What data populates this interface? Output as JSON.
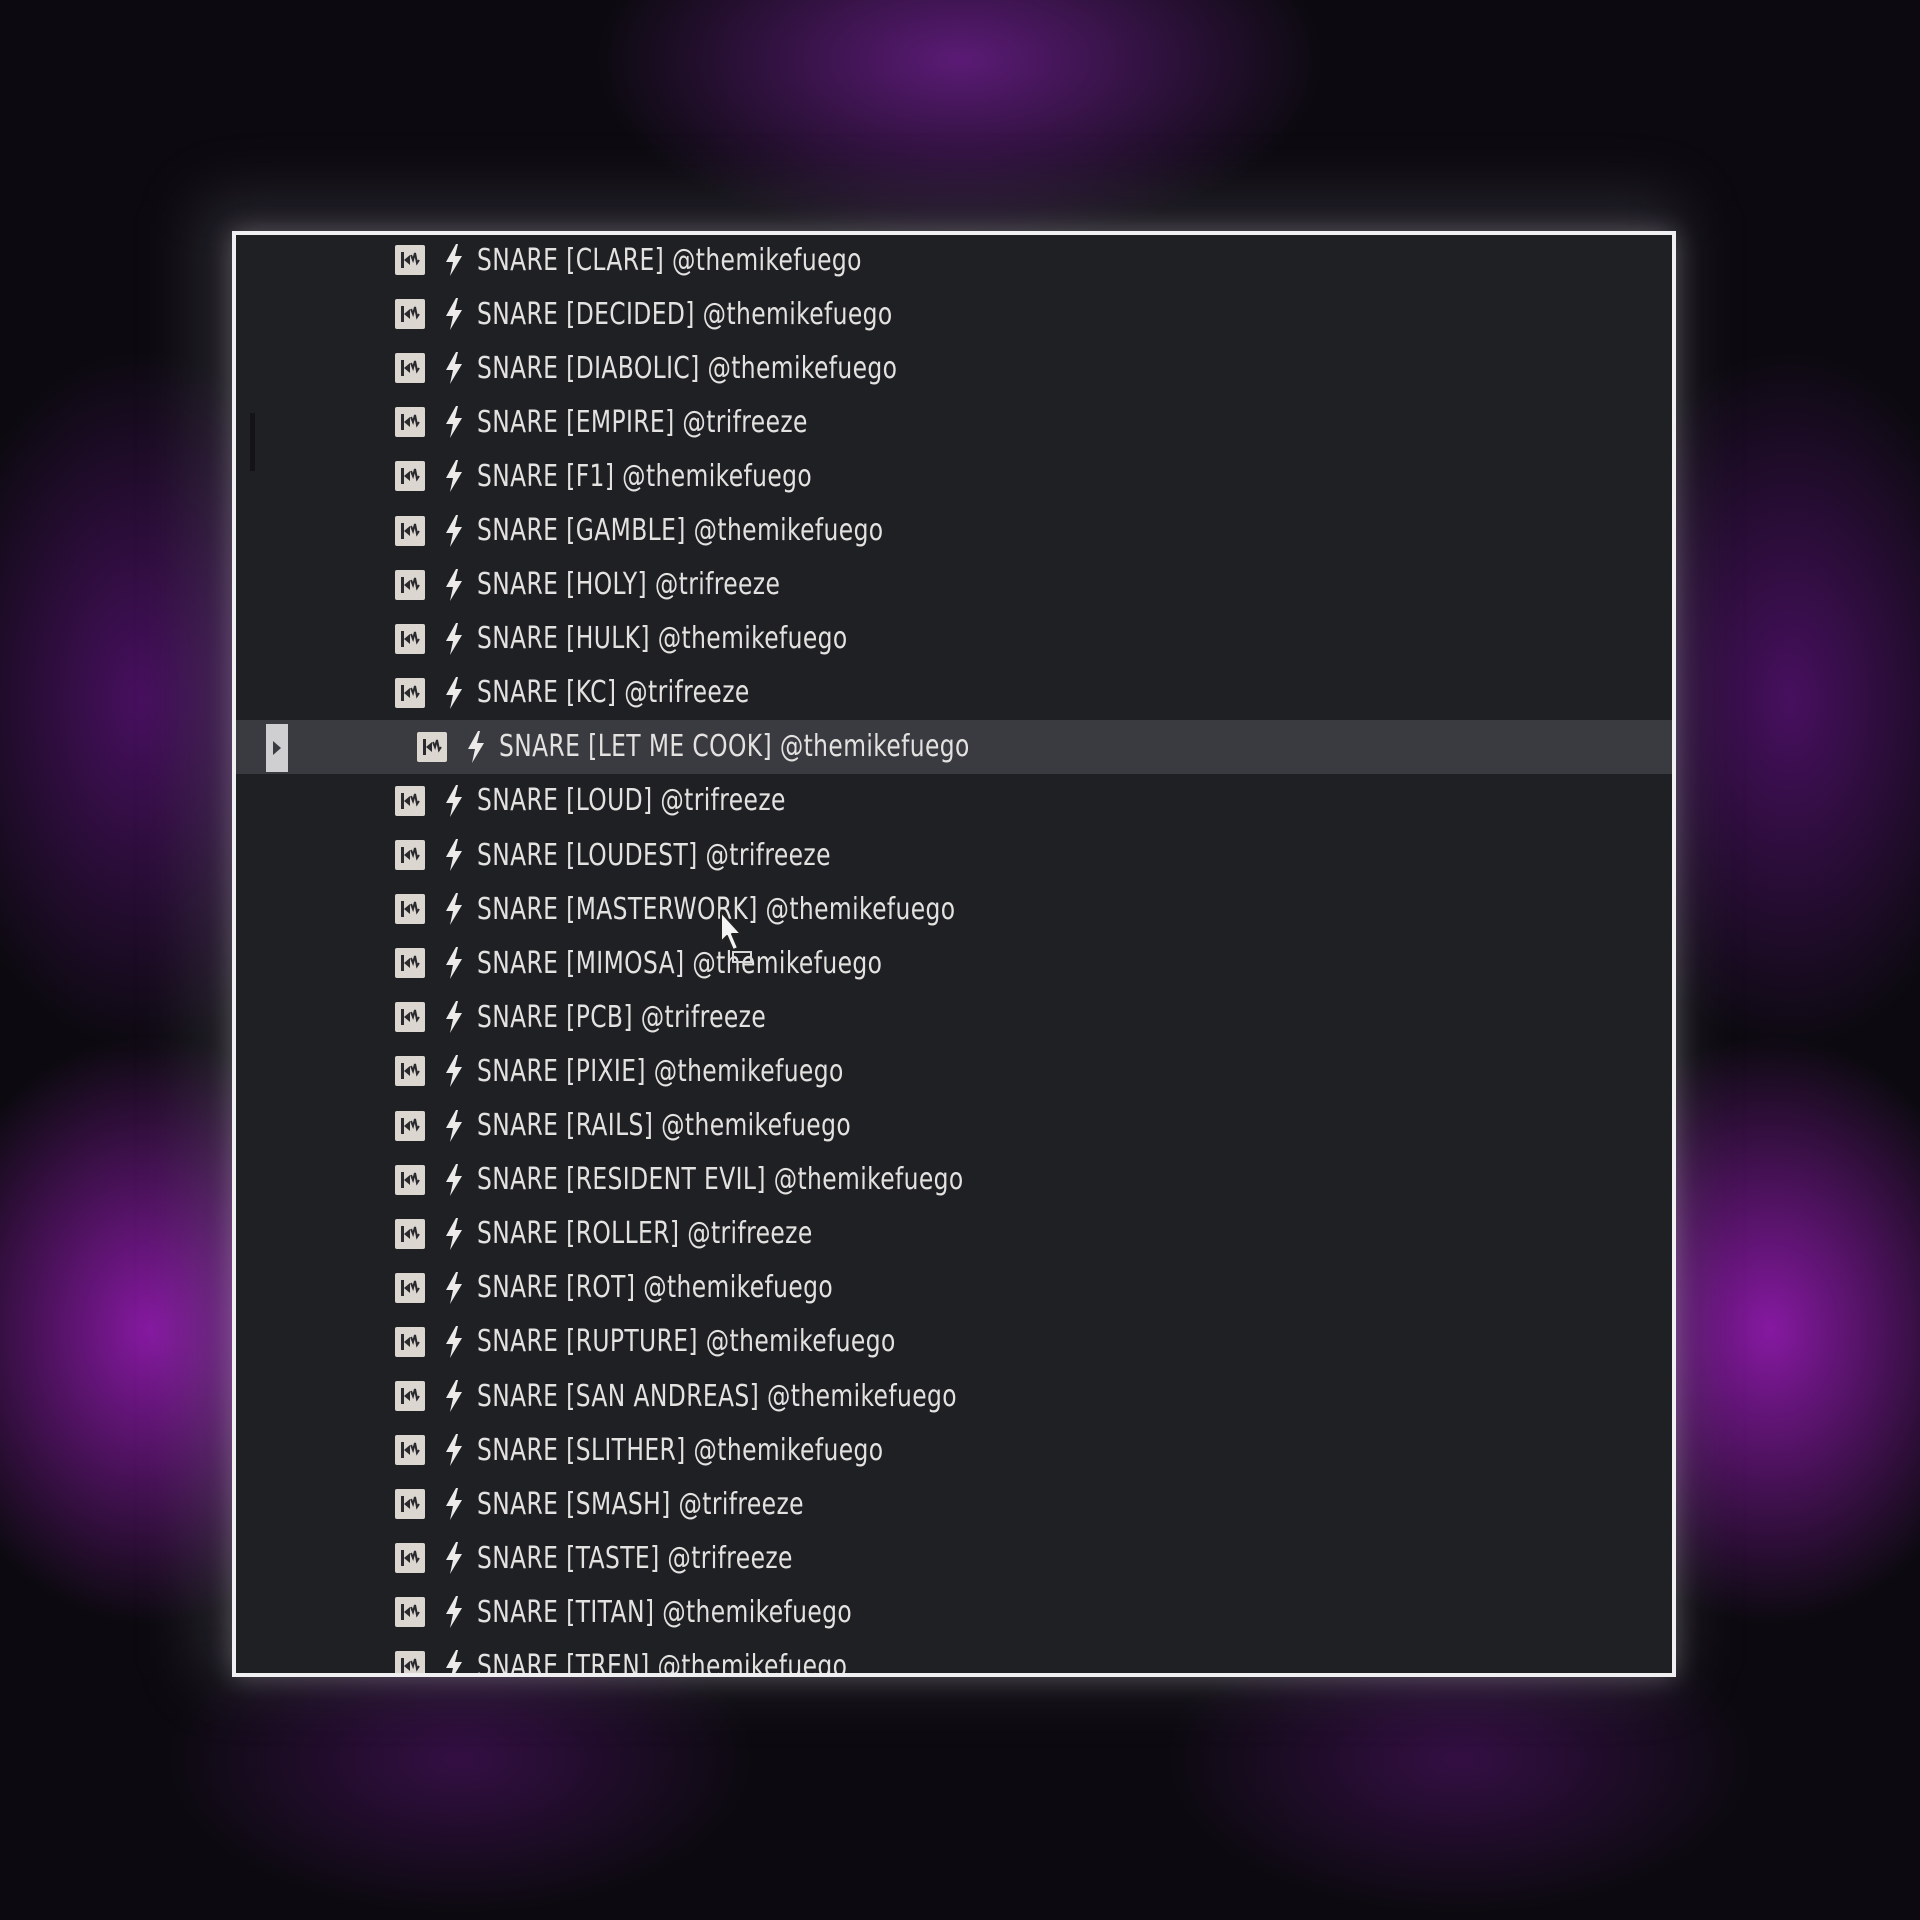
{
  "browser": {
    "items": [
      {
        "label": "SNARE [CLARE] @themikefuego"
      },
      {
        "label": "SNARE [DECIDED] @themikefuego"
      },
      {
        "label": "SNARE [DIABOLIC] @themikefuego"
      },
      {
        "label": "SNARE [EMPIRE] @trifreeze"
      },
      {
        "label": "SNARE [F1] @themikefuego"
      },
      {
        "label": "SNARE [GAMBLE] @themikefuego"
      },
      {
        "label": "SNARE [HOLY] @trifreeze"
      },
      {
        "label": "SNARE [HULK] @themikefuego"
      },
      {
        "label": "SNARE [KC] @trifreeze"
      },
      {
        "label": "SNARE [LET ME COOK] @themikefuego",
        "selected": true
      },
      {
        "label": "SNARE [LOUD] @trifreeze"
      },
      {
        "label": "SNARE [LOUDEST] @trifreeze"
      },
      {
        "label": "SNARE [MASTERWORK] @themikefuego"
      },
      {
        "label": "SNARE [MIMOSA] @themikefuego"
      },
      {
        "label": "SNARE [PCB] @trifreeze"
      },
      {
        "label": "SNARE [PIXIE] @themikefuego"
      },
      {
        "label": "SNARE [RAILS] @themikefuego"
      },
      {
        "label": "SNARE [RESIDENT EVIL] @themikefuego"
      },
      {
        "label": "SNARE [ROLLER] @trifreeze"
      },
      {
        "label": "SNARE [ROT] @themikefuego"
      },
      {
        "label": "SNARE [RUPTURE] @themikefuego"
      },
      {
        "label": "SNARE [SAN ANDREAS] @themikefuego"
      },
      {
        "label": "SNARE [SLITHER] @themikefuego"
      },
      {
        "label": "SNARE [SMASH] @trifreeze"
      },
      {
        "label": "SNARE [TASTE] @trifreeze"
      },
      {
        "label": "SNARE [TITAN] @themikefuego"
      },
      {
        "label": "SNARE [TREN] @themikefuego"
      }
    ],
    "icons": {
      "file": "audio-sample-icon",
      "type": "lightning-bolt-icon",
      "expand": "expand-arrow-icon"
    }
  },
  "colors": {
    "panel_bg": "#1f2024",
    "selected_bg": "#3a3b41",
    "text": "#e4e2e0",
    "accent": "#a020c8"
  }
}
